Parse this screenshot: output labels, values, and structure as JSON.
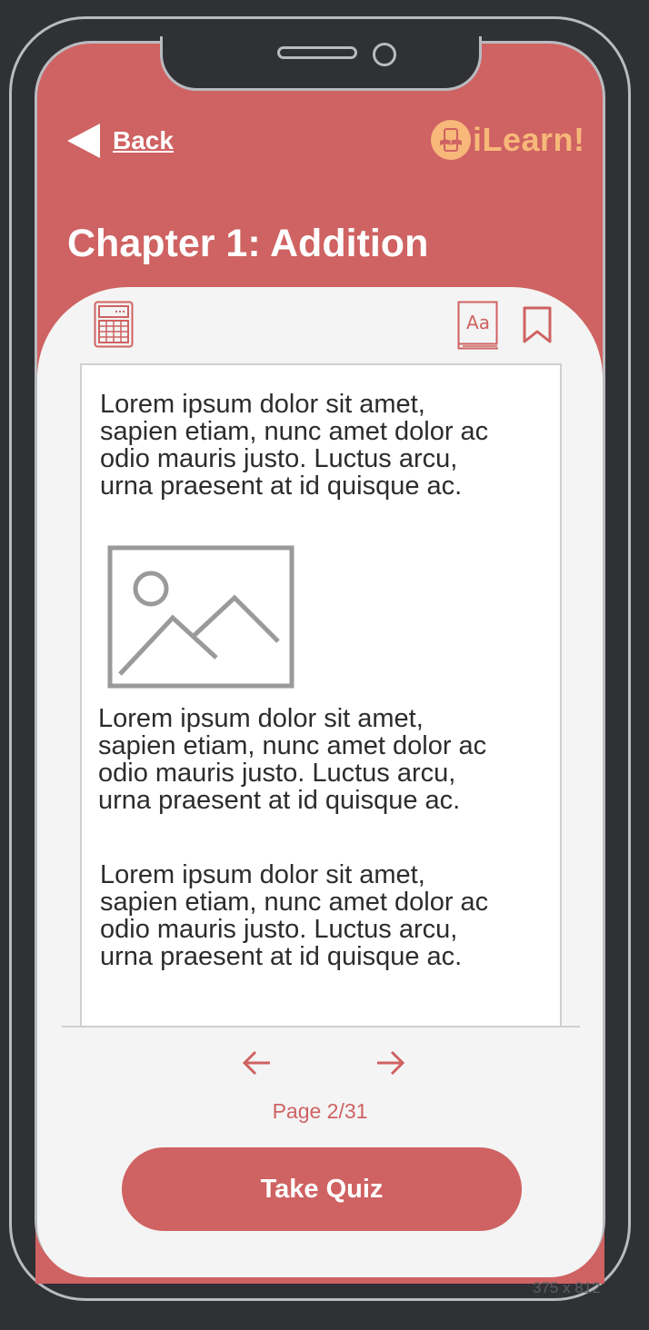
{
  "header": {
    "back_label": "Back",
    "logo_text": "iLearn!",
    "chapter_title": "Chapter 1: Addition"
  },
  "toolbar": {
    "icons": [
      "calculator-icon",
      "dictionary-icon",
      "bookmark-icon"
    ],
    "dictionary_glyph": "Aa"
  },
  "reader": {
    "paragraphs": [
      "Lorem ipsum dolor sit amet, sapien etiam, nunc amet dolor ac odio mauris justo. Luctus arcu, urna praesent at id quisque ac.",
      "Lorem ipsum dolor sit amet, sapien etiam, nunc amet dolor ac odio mauris justo. Luctus arcu, urna praesent at id quisque ac.",
      "Lorem ipsum dolor sit amet, sapien etiam, nunc amet dolor ac odio mauris justo. Luctus arcu, urna praesent at id quisque ac."
    ]
  },
  "pagination": {
    "label": "Page 2/31",
    "current": 2,
    "total": 31
  },
  "actions": {
    "quiz_label": "Take Quiz"
  },
  "frame": {
    "size_label": "375 x 812"
  },
  "colors": {
    "brand": "#cf6262",
    "logo": "#f7b87a",
    "background": "#2f3135",
    "panel": "#f4f4f4"
  }
}
